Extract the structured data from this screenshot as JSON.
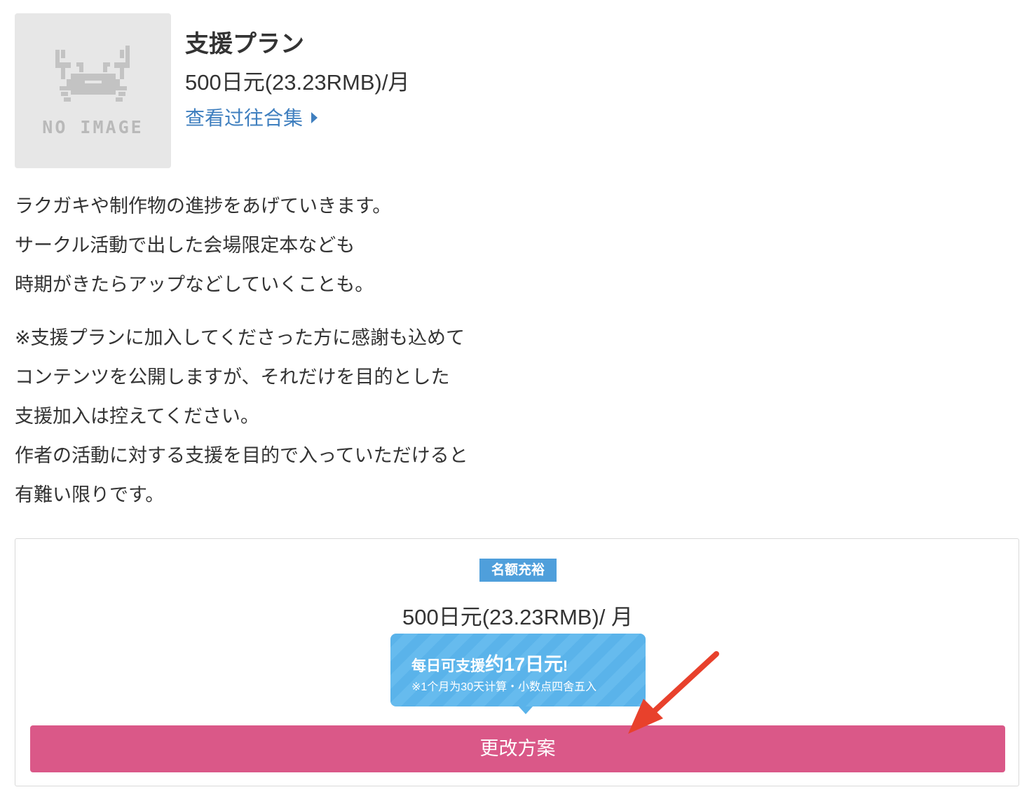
{
  "plan": {
    "thumbnail_text": "NO IMAGE",
    "name": "支援プラン",
    "price": "500日元(23.23RMB)/月",
    "past_link": "查看过往合集"
  },
  "description": {
    "para1": [
      "ラクガキや制作物の進捗をあげていきます。",
      "サークル活動で出した会場限定本なども",
      "時期がきたらアップなどしていくことも。"
    ],
    "para2": [
      "※支援プランに加入してくださった方に感謝も込めて",
      "コンテンツを公開しますが、それだけを目的とした",
      "支援加入は控えてください。",
      "作者の活動に対する支援を目的で入っていただけると",
      "有難い限りです。"
    ]
  },
  "join_box": {
    "badge": "名额充裕",
    "price": "500日元(23.23RMB)/ 月",
    "tooltip": {
      "prefix": "每日可支援",
      "amount": "约17日元",
      "suffix": "!",
      "note": "※1个月为30天计算・小数点四舍五入"
    },
    "button_label": "更改方案"
  },
  "colors": {
    "link": "#3f7fbf",
    "badge": "#4f9fdb",
    "tooltip": "#5ab3ea",
    "button": "#da5888",
    "annotation_arrow": "#e8412c"
  },
  "icons": {
    "thumbnail": "crab-placeholder-icon",
    "link_arrow": "triangle-right-icon"
  }
}
